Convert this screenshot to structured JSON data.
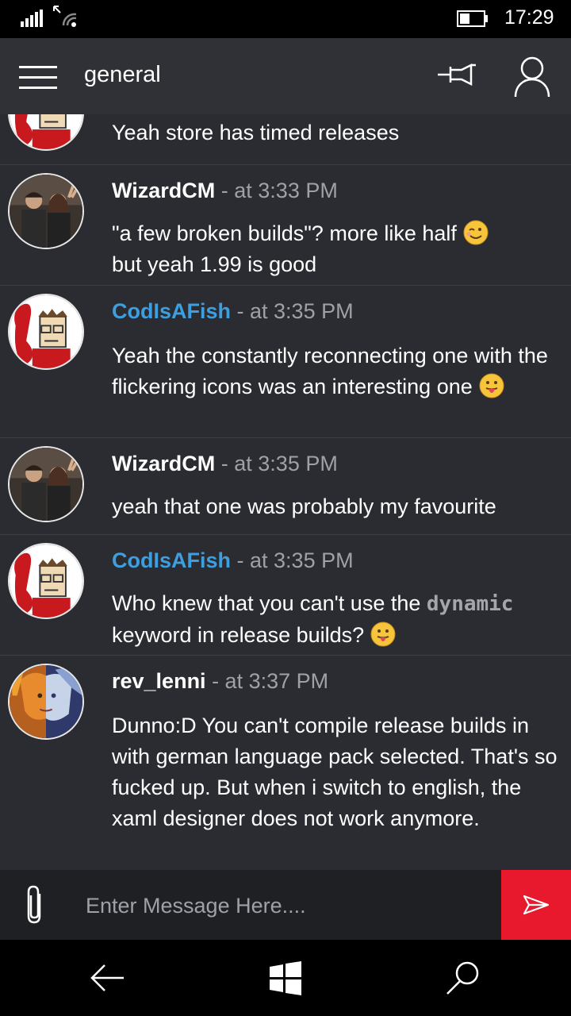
{
  "status_bar": {
    "time": "17:29"
  },
  "header": {
    "channel": "general"
  },
  "messages": [
    {
      "author": "",
      "timestamp": "",
      "text": "Yeah store has timed releases",
      "avatar": "codisafish"
    },
    {
      "author": "WizardCM",
      "timestamp": " - at 3:33 PM",
      "text": "\"a few broken builds\"? more like half",
      "text2": "but yeah 1.99 is good",
      "avatar": "wizardcm",
      "emoji": "wink-emoji"
    },
    {
      "author": "CodIsAFish",
      "timestamp": " - at 3:35 PM",
      "text": "Yeah the constantly reconnecting one with the flickering icons was an interesting one",
      "avatar": "codisafish",
      "emoji": "tongue-emoji"
    },
    {
      "author": "WizardCM",
      "timestamp": " - at 3:35 PM",
      "text": "yeah that one was probably my favourite",
      "avatar": "wizardcm"
    },
    {
      "author": "CodIsAFish",
      "timestamp": " - at 3:35 PM",
      "text_before": "Who knew that you can't use the ",
      "code": "dynamic",
      "text_after": "keyword in release builds?",
      "avatar": "codisafish",
      "emoji": "tongue-emoji"
    },
    {
      "author": "rev_lenni",
      "timestamp": " - at 3:37 PM",
      "text": "Dunno:D You can't compile release builds in with german language pack selected. That's so fucked up. But when i switch to english, the xaml designer does not work anymore.",
      "avatar": "rev_lenni"
    }
  ],
  "composer": {
    "placeholder": "Enter Message Here...."
  },
  "colors": {
    "accent_blue": "#3d9ee0",
    "send_red": "#e8192c",
    "background": "#2a2c31",
    "header": "#2f3136"
  }
}
